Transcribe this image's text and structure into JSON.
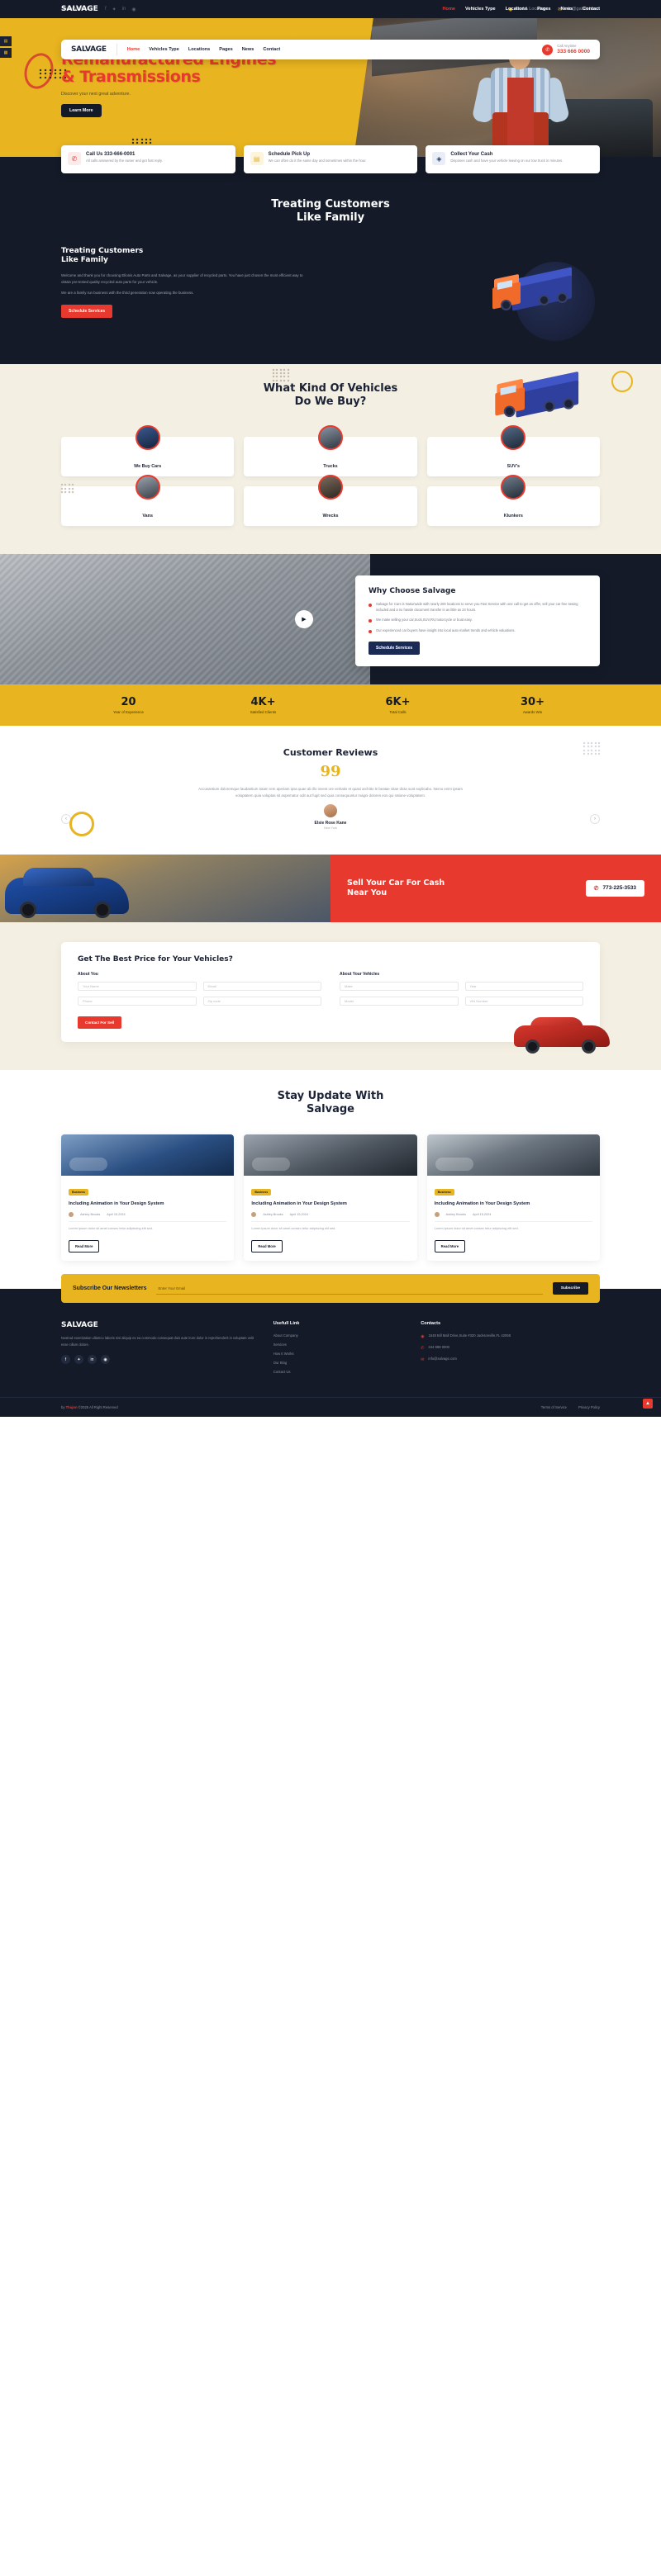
{
  "topbar": {
    "share_label": "Share With Us:",
    "socials": [
      "facebook-icon",
      "twitter-icon",
      "linkedin-icon",
      "pinterest-icon"
    ],
    "find_location": "Find A Location",
    "email": "info@gabriel.com"
  },
  "navbar": {
    "logo": "SALVAGE",
    "menu": [
      {
        "label": "Home",
        "active": true
      },
      {
        "label": "Vehicles Type",
        "active": false
      },
      {
        "label": "Locations",
        "active": false
      },
      {
        "label": "Pages",
        "active": false
      },
      {
        "label": "News",
        "active": false
      },
      {
        "label": "Contact",
        "active": false
      }
    ],
    "call_label": "Call Anytime",
    "call_number": "333 666 0000"
  },
  "topnav": {
    "brand": "SALVAGE",
    "menu": [
      {
        "label": "Home",
        "active": true
      },
      {
        "label": "Vehicles Type",
        "active": false
      },
      {
        "label": "Locations",
        "active": false
      },
      {
        "label": "Pages",
        "active": false
      },
      {
        "label": "News",
        "active": false
      },
      {
        "label": "Contact",
        "active": false
      }
    ]
  },
  "hero": {
    "title_line1": "Remanufactured Engines",
    "title_line2": "& Transmissions",
    "subtitle": "Discover your next great adventure.",
    "button": "Learn More"
  },
  "features": [
    {
      "icon": "phone-icon",
      "title": "Call Us 333-666-0001",
      "text": "All calls answered by the owner and get fast reply."
    },
    {
      "icon": "calendar-icon",
      "title": "Schedule Pick Up",
      "text": "We can often do it the same day and sometimes within the hour."
    },
    {
      "icon": "cash-icon",
      "title": "Collect Your Cash",
      "text": "Disposes cash and have your vehicle leaving on our tow truck in minutes."
    }
  ],
  "treating": {
    "heading_line1": "Treating Customers",
    "heading_line2": "Like Family",
    "sub_line1": "Treating Customers",
    "sub_line2": "Like Family",
    "paragraph1": "Welcome and thank you for choosing Ellonis Auto Parts and Salvage, as your supplier of recycled parts. You have just chosen the most efficient way to obtain pre-tested quality recycled auto parts for your vehicle.",
    "paragraph2": "We are a family run business with the third generation now operating the business.",
    "button": "Schedule Services"
  },
  "vehicles": {
    "heading_line1": "What Kind Of Vehicles",
    "heading_line2": "Do We Buy?",
    "categories": [
      {
        "label": "We Buy Cars"
      },
      {
        "label": "Trucks"
      },
      {
        "label": "SUV's"
      },
      {
        "label": "Vans"
      },
      {
        "label": "Wrecks"
      },
      {
        "label": "Klunkers"
      }
    ]
  },
  "why": {
    "title": "Why Choose Salvage",
    "play_icon": "play-icon",
    "bullets": [
      "Salvage for Cars is Nationwide with nearly 200 locations to serve you Fast Service with one call to get an offer, sell your car free towing included and a no hassle document transfer in as little as 24 hours.",
      "We make selling your car,truck,SUV,RV,motorcycle or boat easy.",
      "Our experienced car buyers have insight into local auto market trends and vehicle valuations."
    ],
    "button": "Schedule Services"
  },
  "stats": [
    {
      "number": "20",
      "label": "Year of Experience"
    },
    {
      "number": "4K+",
      "label": "Satisfied Clients"
    },
    {
      "number": "6K+",
      "label": "Total Calls"
    },
    {
      "number": "30+",
      "label": "Awards Win"
    }
  ],
  "reviews": {
    "title": "Customer Reviews",
    "quote_mark": "99",
    "text": "Accusantium doloremque laudantium totam rem aperiam ipsa quae ab illo invent ore veritatis et quasi architto le beatae vitae dicta sunt explicabo. Nemo enim ipsam voluptatem quia voluptas sit aspernatur odit aut fugit sed quia consequuntur magni dolores eos qui ratione voluptatem.",
    "name": "Elsie Rose Kane",
    "location": "New York",
    "prev_icon": "arrow-left-icon",
    "next_icon": "arrow-right-icon"
  },
  "sell": {
    "title_line1": "Sell Your Car For Cash",
    "title_line2": "Near You",
    "phone": "773-225-3533",
    "phone_icon": "phone-icon"
  },
  "quote": {
    "title": "Get The Best Price for Your Vehicles?",
    "group_about_you": "About You",
    "group_about_vehicles": "About Your Vehicles",
    "fields_you": [
      {
        "placeholder": "Your Name"
      },
      {
        "placeholder": "Email"
      },
      {
        "placeholder": "Phone"
      },
      {
        "placeholder": "Zip code"
      }
    ],
    "fields_vehicle": [
      {
        "placeholder": "Make"
      },
      {
        "placeholder": "Year"
      },
      {
        "placeholder": "Model"
      },
      {
        "placeholder": "VIN Number"
      }
    ],
    "button": "Contact For Sell"
  },
  "blog": {
    "heading_line1": "Stay Update With",
    "heading_line2": "Salvage",
    "posts": [
      {
        "tag": "Business",
        "title": "Including Animation in Your Design System",
        "author": "Ashley Brooks",
        "date": "April 15,2024",
        "excerpt": "Lorem ipsum dolor sit amet consec tetur adipiscing elit sed.",
        "button": "Read More"
      },
      {
        "tag": "Business",
        "title": "Including Animation in Your Design System",
        "author": "Ashley Brooks",
        "date": "April 15,2024",
        "excerpt": "Lorem ipsum dolor sit amet consec tetur adipiscing elit sed.",
        "button": "Read More"
      },
      {
        "tag": "Business",
        "title": "Including Animation in Your Design System",
        "author": "Ashley Brooks",
        "date": "April 15,2024",
        "excerpt": "Lorem ipsum dolor sit amet consec tetur adipiscing elit sed.",
        "button": "Read More"
      }
    ]
  },
  "newsletter": {
    "title": "Subscribe Our Newsletters",
    "placeholder": "Enter Your Email",
    "button": "Subscribe"
  },
  "footer": {
    "brand": "SALVAGE",
    "about": "Nostrud exercitation ullamco laboris nisi aliquip ex ea commodo consequat duis aute irure dolor in reprehenderit in voluptate velit esse cillum dolore.",
    "socials": [
      "facebook-icon",
      "twitter-icon",
      "linkedin-icon",
      "pinterest-icon"
    ],
    "useful_title": "Usefull Link",
    "useful_links": [
      "About Company",
      "Services",
      "How It Works",
      "Our Blog",
      "Contact Us"
    ],
    "contacts_title": "Contacts",
    "address": "1548 Bill Mall Drive,Suite #320 Jacksonville,FL 42068",
    "phone": "444 888 0000",
    "email": "info@salvage.com",
    "phone_icon": "phone-icon",
    "email_icon": "mail-icon",
    "pin_icon": "map-pin-icon",
    "copyright_pre": "by ",
    "copyright_brand": "Thujon",
    "copyright_post": " ©2025 All Right Reserved",
    "bottom_links": [
      "Terms of Service",
      "Privacy Policy"
    ],
    "to_top_icon": "arrow-up-icon"
  },
  "rail": [
    "shop-icon",
    "cart-icon"
  ],
  "colors": {
    "yellow": "#e8b520",
    "red": "#e8392e",
    "navy": "#141a28",
    "cream": "#f3efe3"
  }
}
